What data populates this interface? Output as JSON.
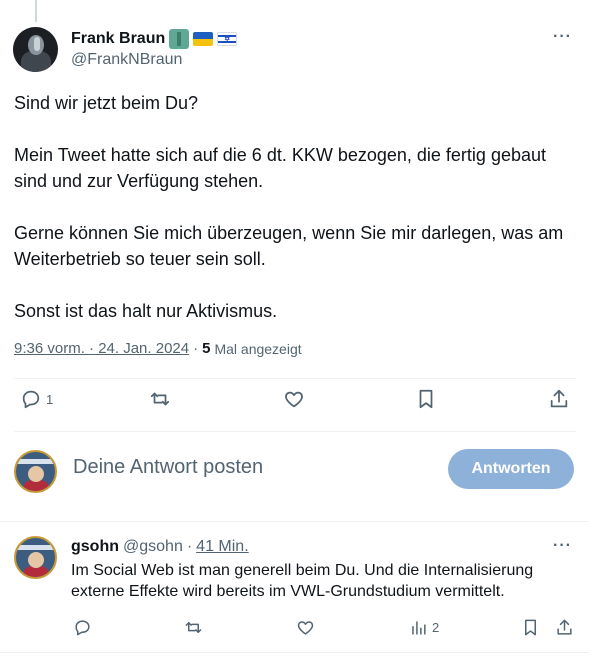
{
  "main_tweet": {
    "author_name": "Frank Braun",
    "author_handle": "@FrankNBraun",
    "more_label": "···",
    "paragraphs": [
      "Sind wir jetzt beim Du?",
      "",
      "Mein Tweet hatte sich auf die 6 dt. KKW bezogen, die fertig gebaut sind und zur Verfügung stehen.",
      "",
      "Gerne können Sie mich überzeugen, wenn Sie mir darlegen, was am Weiterbetrieb so teuer sein soll.",
      "",
      " Sonst ist das halt nur Aktivismus."
    ],
    "timestamp": "9:36 vorm. · 24. Jan. 2024",
    "separator": "·",
    "views_count": "5",
    "views_label": "Mal angezeigt",
    "actions": {
      "reply_count": "1",
      "retweet_count": "",
      "like_count": ""
    }
  },
  "reply_composer": {
    "placeholder": "Deine Antwort posten",
    "button_label": "Antworten",
    "button_color": "#8eb1d9"
  },
  "reply_tweet": {
    "author_name": "gsohn",
    "author_handle": "@gsohn",
    "separator": "·",
    "time": "41 Min.",
    "more_label": "···",
    "text": "Im Social Web ist man generell beim Du. Und die Internalisierung externe Effekte wird bereits im VWL-Grundstudium vermittelt.",
    "actions": {
      "views_count": "2"
    }
  },
  "colors": {
    "text_primary": "#0f1419",
    "text_secondary": "#536471",
    "divider": "#eff3f4"
  }
}
